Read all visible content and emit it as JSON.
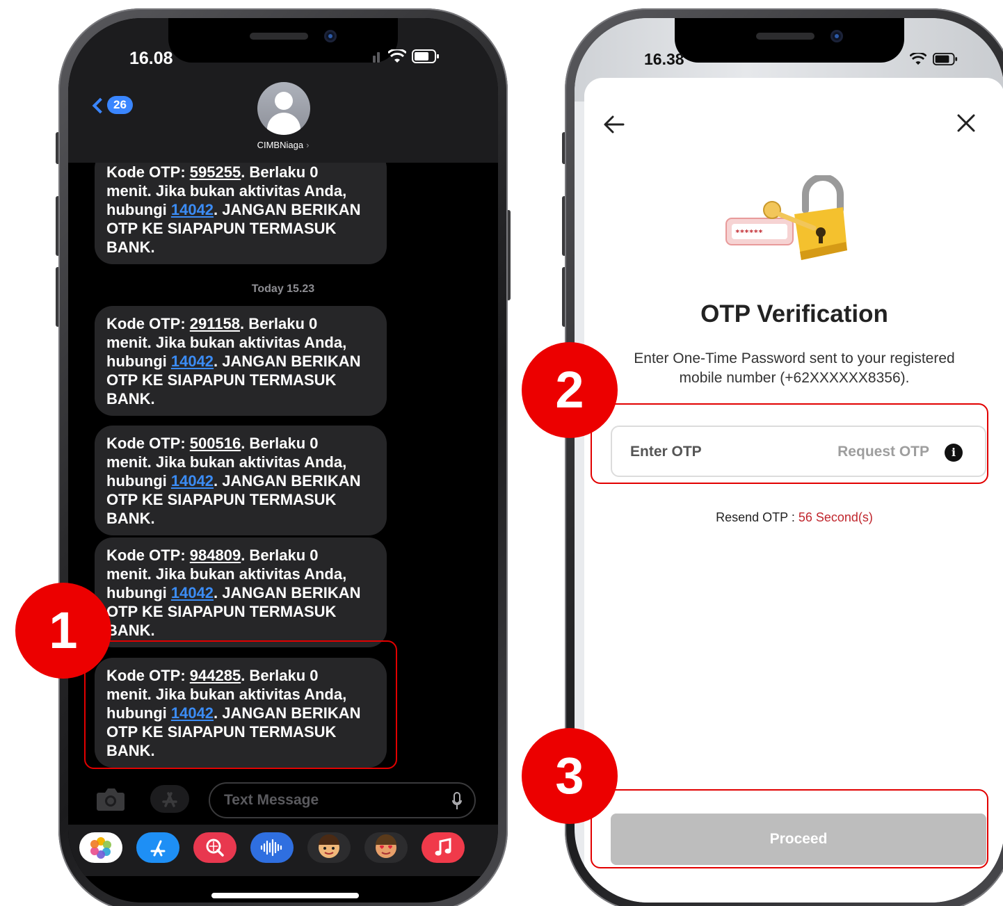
{
  "left_phone": {
    "status_time": "16.08",
    "back_badge": "26",
    "contact_name": "CIMBNiaga",
    "timestamp": "Today 15.23",
    "messages": [
      {
        "prefix": "Kode OTP: ",
        "code": "595255",
        "l1_suffix": ". Berlaku 0",
        "line2": "menit. Jika bukan aktivitas Anda,",
        "l3_prefix": "hubungi ",
        "phone": "14042",
        "l3_suffix": ". JANGAN BERIKAN",
        "line4": "OTP KE SIAPAPUN TERMASUK",
        "line5": "BANK."
      },
      {
        "prefix": "Kode OTP: ",
        "code": "291158",
        "l1_suffix": ". Berlaku 0",
        "line2": "menit. Jika bukan aktivitas Anda,",
        "l3_prefix": "hubungi ",
        "phone": "14042",
        "l3_suffix": ". JANGAN BERIKAN",
        "line4": "OTP KE SIAPAPUN TERMASUK",
        "line5": "BANK."
      },
      {
        "prefix": "Kode OTP: ",
        "code": "500516",
        "l1_suffix": ". Berlaku 0",
        "line2": "menit. Jika bukan aktivitas Anda,",
        "l3_prefix": "hubungi ",
        "phone": "14042",
        "l3_suffix": ". JANGAN BERIKAN",
        "line4": "OTP KE SIAPAPUN TERMASUK",
        "line5": "BANK."
      },
      {
        "prefix": "Kode OTP: ",
        "code": "984809",
        "l1_suffix": ". Berlaku 0",
        "line2": "menit. Jika bukan aktivitas Anda,",
        "l3_prefix": "hubungi ",
        "phone": "14042",
        "l3_suffix": ". JANGAN BERIKAN",
        "line4": "OTP KE SIAPAPUN TERMASUK",
        "line5": "BANK."
      },
      {
        "prefix": "Kode OTP: ",
        "code": "944285",
        "l1_suffix": ". Berlaku 0",
        "line2": "menit. Jika bukan aktivitas Anda,",
        "l3_prefix": "hubungi ",
        "phone": "14042",
        "l3_suffix": ". JANGAN BERIKAN",
        "line4": "OTP KE SIAPAPUN TERMASUK",
        "line5": "BANK."
      }
    ],
    "input_placeholder": "Text Message",
    "tray_icons": [
      "photos-icon",
      "app-store-icon",
      "search-images-icon",
      "audio-message-icon",
      "memoji-icon",
      "animoji-icon",
      "music-icon"
    ]
  },
  "right_phone": {
    "status_time": "16.38",
    "title": "OTP Verification",
    "description_line1": "Enter One-Time Password sent to your registered",
    "description_line2": "mobile number (+62XXXXXX8356).",
    "otp_placeholder": "Enter OTP",
    "request_otp_label": "Request OTP",
    "info_glyph": "i",
    "resend_label": "Resend OTP : ",
    "resend_count": "56 Second(s)",
    "proceed_label": "Proceed",
    "illustration_mask": "******"
  },
  "annotations": [
    "1",
    "2",
    "3"
  ],
  "colors": {
    "annotation_red": "#ec0000",
    "imessage_link": "#3b8cf5",
    "bubble": "#262628",
    "countdown_red": "#c0262d",
    "proceed_disabled": "#bdbdbd"
  }
}
